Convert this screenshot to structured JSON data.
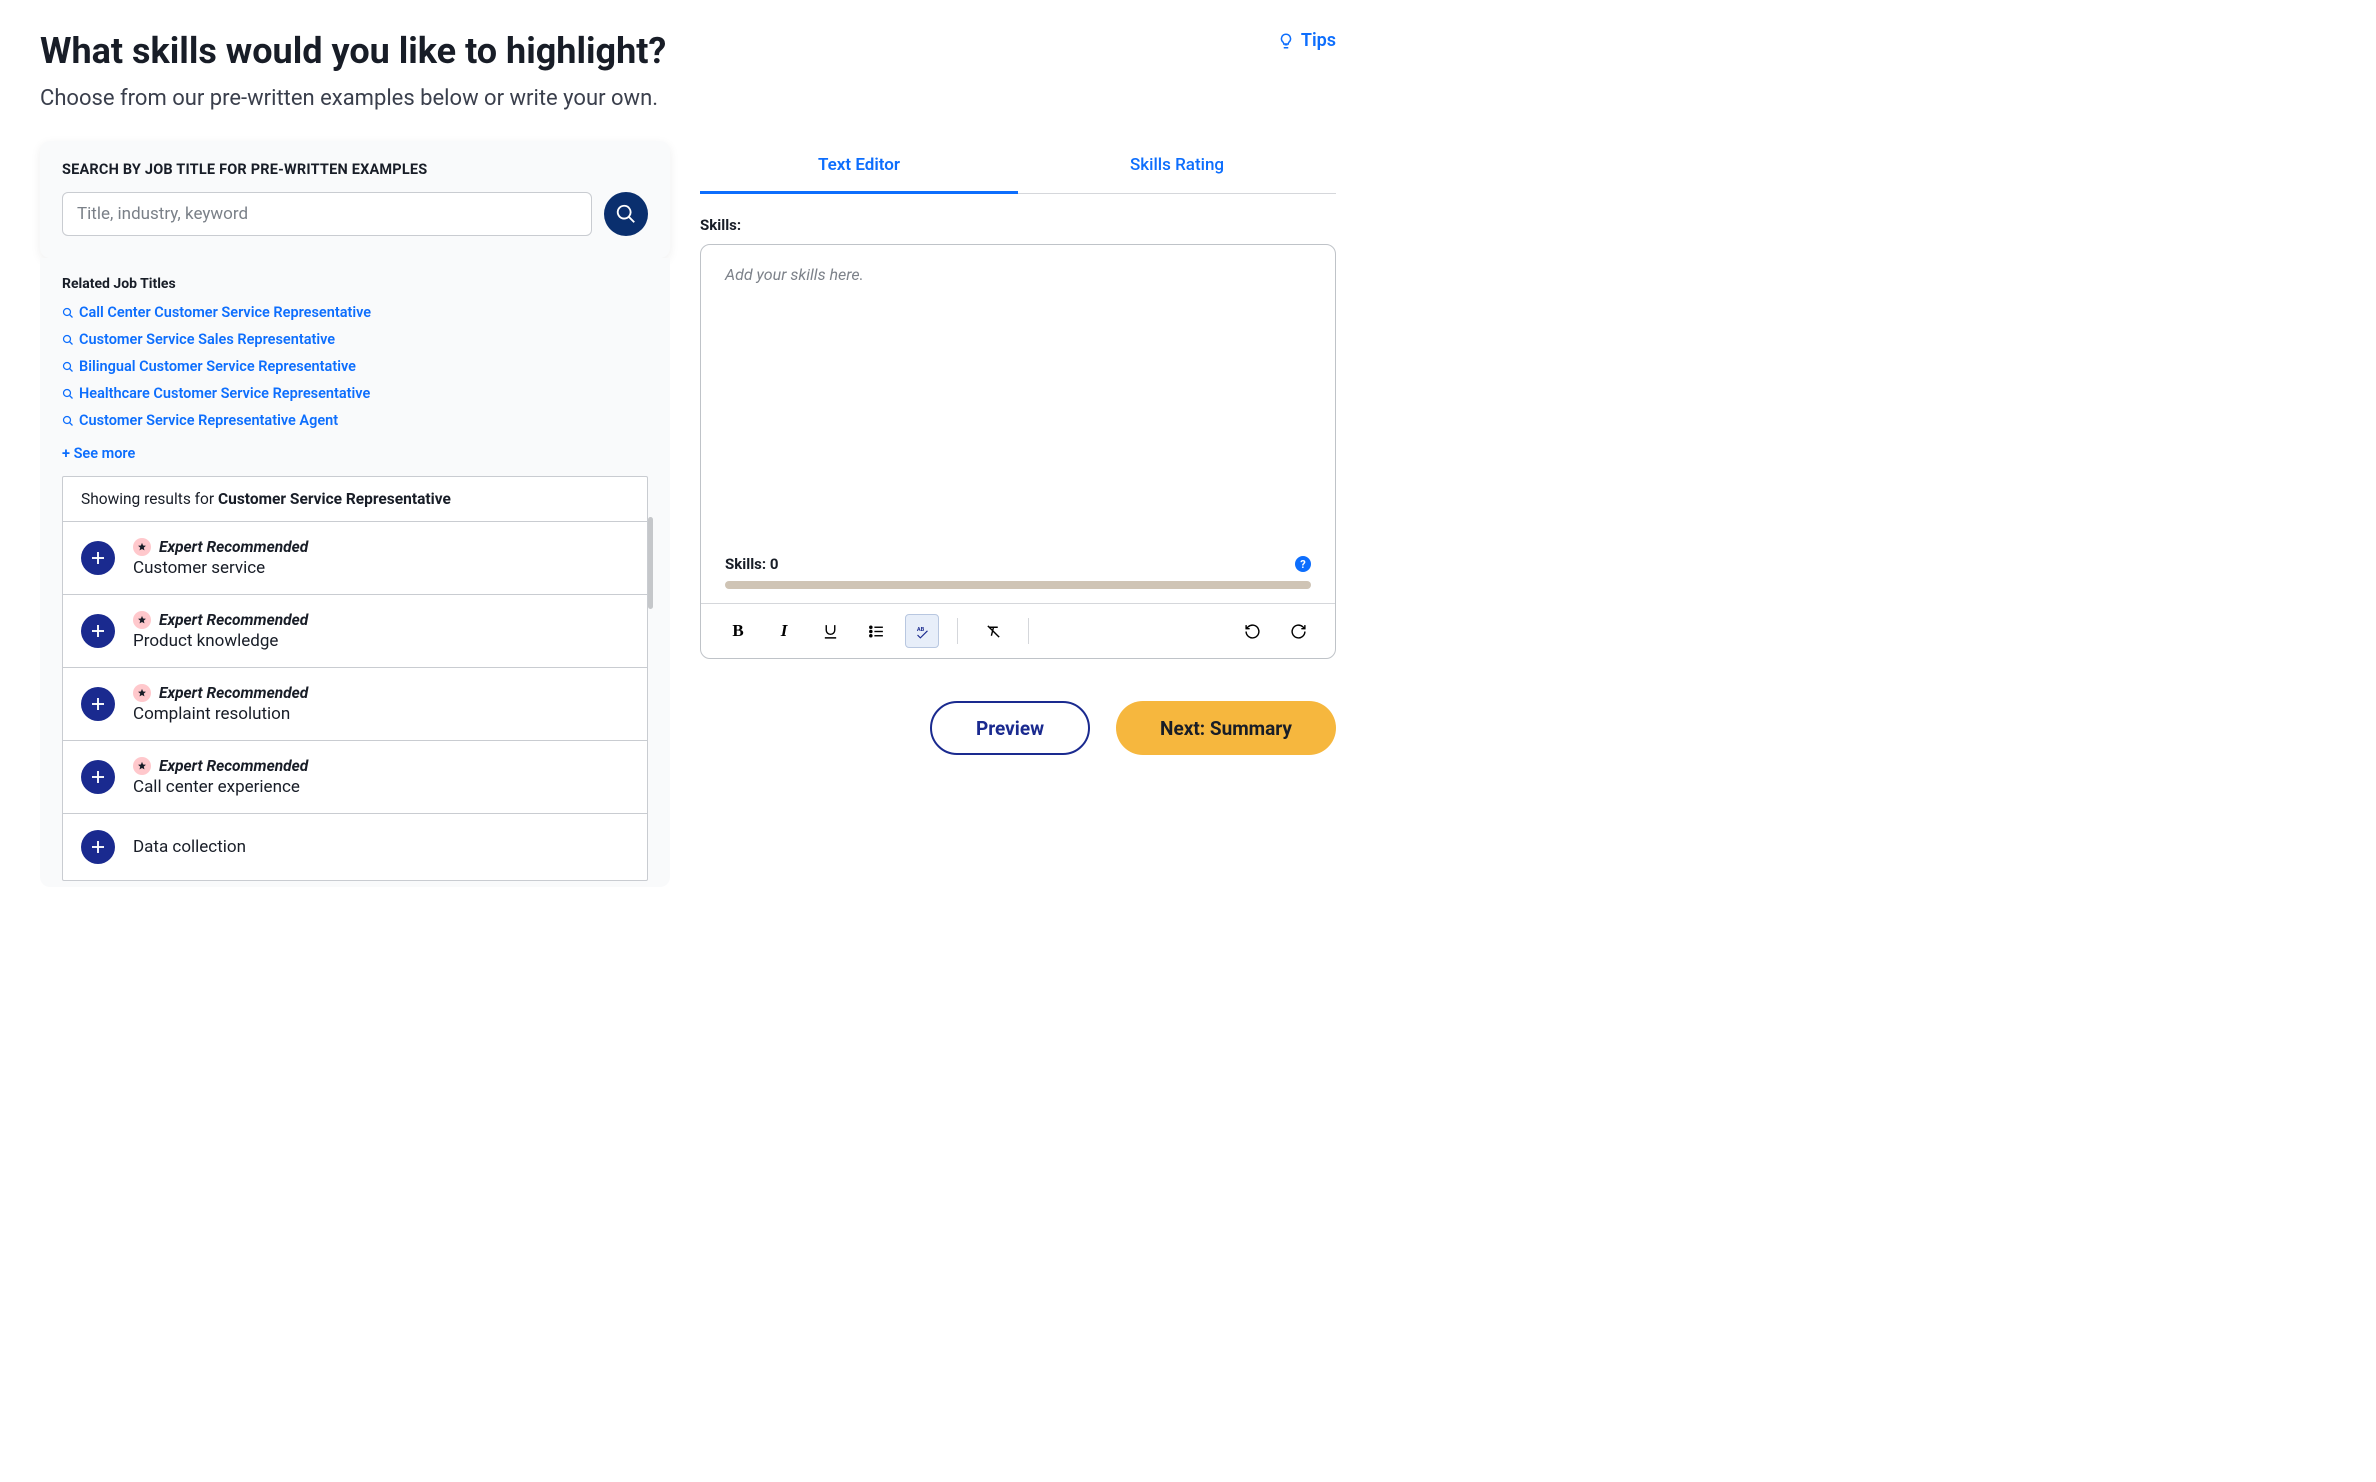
{
  "page": {
    "title": "What skills would you like to highlight?",
    "subtitle": "Choose from our pre-written examples below or write your own.",
    "tips_label": "Tips"
  },
  "search": {
    "label": "SEARCH BY JOB TITLE FOR PRE-WRITTEN EXAMPLES",
    "placeholder": "Title, industry, keyword"
  },
  "related": {
    "title": "Related Job Titles",
    "links": [
      "Call Center Customer Service Representative",
      "Customer Service Sales Representative",
      "Bilingual Customer Service Representative",
      "Healthcare Customer Service Representative",
      "Customer Service Representative Agent"
    ],
    "see_more": "+ See more"
  },
  "results": {
    "header_prefix": "Showing results for ",
    "header_term": "Customer Service Representative",
    "items": [
      {
        "recommended": true,
        "rec_label": "Expert Recommended",
        "text": "Customer service"
      },
      {
        "recommended": true,
        "rec_label": "Expert Recommended",
        "text": "Product knowledge"
      },
      {
        "recommended": true,
        "rec_label": "Expert Recommended",
        "text": "Complaint resolution"
      },
      {
        "recommended": true,
        "rec_label": "Expert Recommended",
        "text": "Call center experience"
      },
      {
        "recommended": false,
        "rec_label": "",
        "text": "Data collection"
      }
    ]
  },
  "tabs": {
    "text_editor": "Text Editor",
    "skills_rating": "Skills Rating"
  },
  "editor": {
    "section_label": "Skills:",
    "placeholder": "Add your skills here.",
    "count_label": "Skills: 0"
  },
  "footer": {
    "preview": "Preview",
    "next": "Next: Summary"
  }
}
